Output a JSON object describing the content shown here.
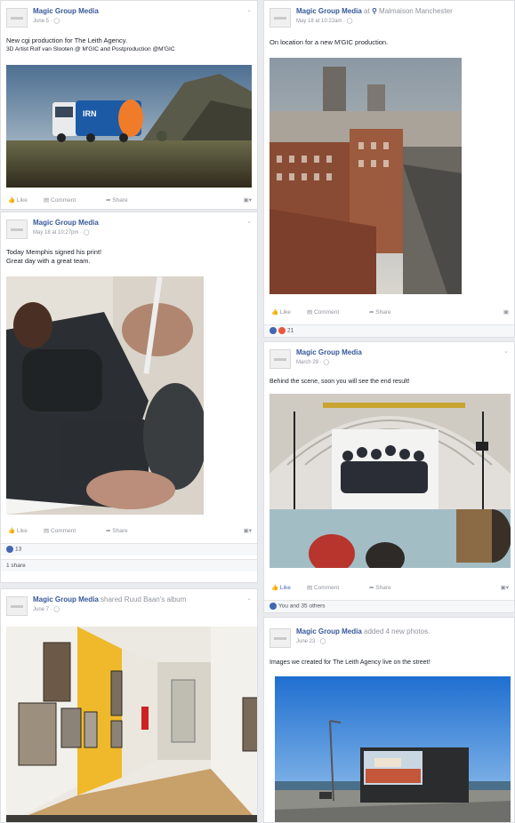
{
  "feed": {
    "author": "Magic Group Media",
    "posts": [
      {
        "id": "truck",
        "meta": "June 5 · ",
        "text": [
          "New cgi production for The Leith Agency.",
          "3D Artist Rolf van Slooten @ M'GIC and Postproduction @M'GIC"
        ],
        "actions": {
          "like": "Like",
          "comment": "Comment",
          "share": "Share"
        }
      },
      {
        "id": "location",
        "author_suffix": "at",
        "location": "Malmaison Manchester",
        "meta": "May 18 at 10:22am · ",
        "text": [
          "On location for a new M'GIC production."
        ],
        "actions": {
          "like": "Like",
          "comment": "Comment",
          "share": "Share"
        },
        "reactions": "21"
      },
      {
        "id": "memphis",
        "meta": "May 18 at 10:27pm · ",
        "text": [
          "Today Memphis signed his print!",
          "Great day with a great team."
        ],
        "actions": {
          "like": "Like",
          "comment": "Comment",
          "share": "Share"
        },
        "reactions": "13",
        "shares": "1 share"
      },
      {
        "id": "scenes",
        "meta": "March 29 · ",
        "text": [
          "Behind the scene, soon you will see the end result!"
        ],
        "actions": {
          "like": "Like",
          "comment": "Comment",
          "share": "Share"
        },
        "reactions": "You and 35 others"
      },
      {
        "id": "album",
        "author_suffix": "shared Ruud Baan's album",
        "meta": "June 7 · "
      },
      {
        "id": "billboard",
        "author_suffix": "added 4 new photos.",
        "meta": "June 23 · ",
        "text": [
          "Images we created for The Leith Agency live on the street!"
        ]
      }
    ]
  },
  "colors": {
    "link": "#365899",
    "like_active": "#4267b2",
    "reaction_love": "#e9573f"
  }
}
